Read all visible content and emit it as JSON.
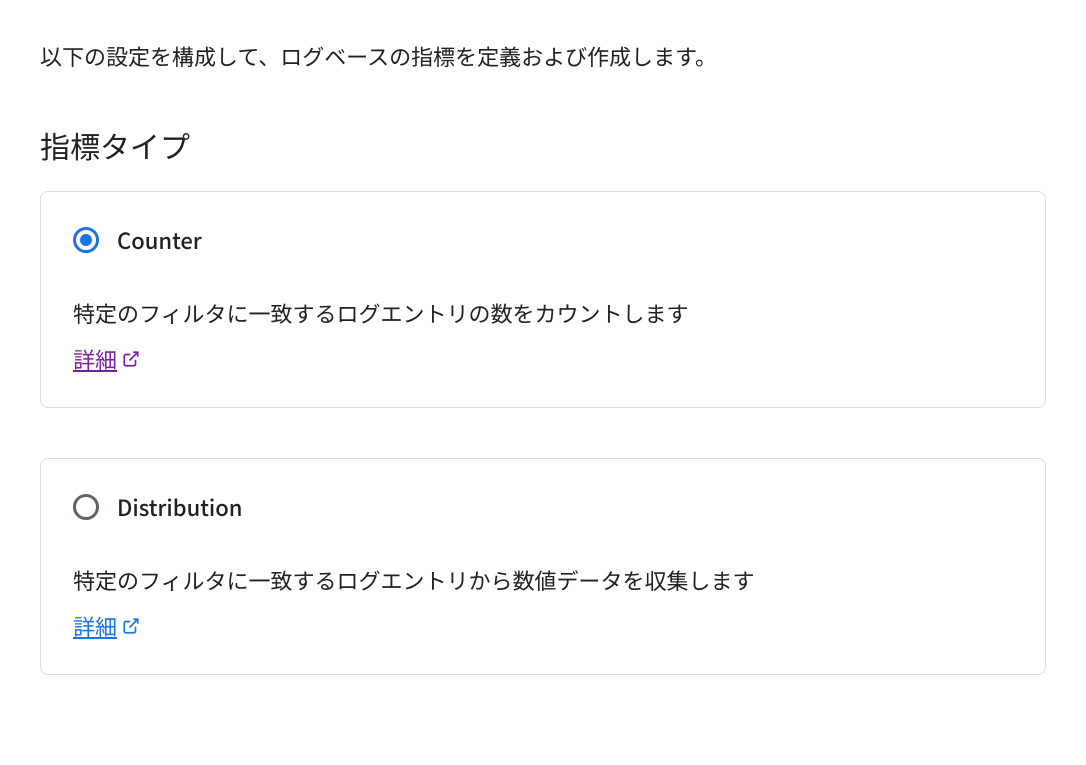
{
  "intro": "以下の設定を構成して、ログベースの指標を定義および作成します。",
  "sectionTitle": "指標タイプ",
  "options": {
    "counter": {
      "label": "Counter",
      "description": "特定のフィルタに一致するログエントリの数をカウントします",
      "linkText": "詳細",
      "selected": true
    },
    "distribution": {
      "label": "Distribution",
      "description": "特定のフィルタに一致するログエントリから数値データを収集します",
      "linkText": "詳細",
      "selected": false
    }
  },
  "colors": {
    "selectedRadio": "#1a73e8",
    "unselectedRadio": "#5f6368",
    "visitedLink": "#7b1fa2",
    "defaultLink": "#1a73e8"
  }
}
